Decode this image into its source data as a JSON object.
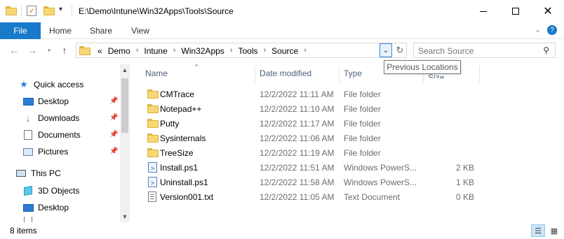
{
  "window": {
    "title": "E:\\Demo\\Intune\\Win32Apps\\Tools\\Source",
    "minimize_icon": "minimize-icon",
    "maximize_icon": "maximize-icon",
    "close_icon": "close-icon"
  },
  "ribbon": {
    "tabs": [
      {
        "label": "File"
      },
      {
        "label": "Home"
      },
      {
        "label": "Share"
      },
      {
        "label": "View"
      }
    ],
    "file_tab_color": "#1979ca"
  },
  "address": {
    "overflow": "«",
    "crumbs": [
      "Demo",
      "Intune",
      "Win32Apps",
      "Tools",
      "Source"
    ]
  },
  "search": {
    "placeholder": "Search Source"
  },
  "tooltip": {
    "text": "Previous Locations"
  },
  "navpane": {
    "quick_access": "Quick access",
    "quick_items": [
      "Desktop",
      "Downloads",
      "Documents",
      "Pictures"
    ],
    "this_pc": "This PC",
    "pc_items": [
      "3D Objects",
      "Desktop"
    ]
  },
  "columns": {
    "name": "Name",
    "date": "Date modified",
    "type": "Type",
    "size": "Size"
  },
  "files": [
    {
      "name": "CMTrace",
      "date": "12/2/2022 11:11 AM",
      "type": "File folder",
      "size": "",
      "icon": "folder-icon"
    },
    {
      "name": "Notepad++",
      "date": "12/2/2022 11:10 AM",
      "type": "File folder",
      "size": "",
      "icon": "folder-icon"
    },
    {
      "name": "Putty",
      "date": "12/2/2022 11:17 AM",
      "type": "File folder",
      "size": "",
      "icon": "folder-icon"
    },
    {
      "name": "Sysinternals",
      "date": "12/2/2022 11:06 AM",
      "type": "File folder",
      "size": "",
      "icon": "folder-icon"
    },
    {
      "name": "TreeSize",
      "date": "12/2/2022 11:19 AM",
      "type": "File folder",
      "size": "",
      "icon": "folder-icon"
    },
    {
      "name": "Install.ps1",
      "date": "12/2/2022 11:51 AM",
      "type": "Windows PowerS...",
      "size": "2 KB",
      "icon": "powershell-icon"
    },
    {
      "name": "Uninstall.ps1",
      "date": "12/2/2022 11:58 AM",
      "type": "Windows PowerS...",
      "size": "1 KB",
      "icon": "powershell-icon"
    },
    {
      "name": "Version001.txt",
      "date": "12/2/2022 11:05 AM",
      "type": "Text Document",
      "size": "0 KB",
      "icon": "text-file-icon"
    }
  ],
  "status": {
    "item_count": "8 items"
  }
}
